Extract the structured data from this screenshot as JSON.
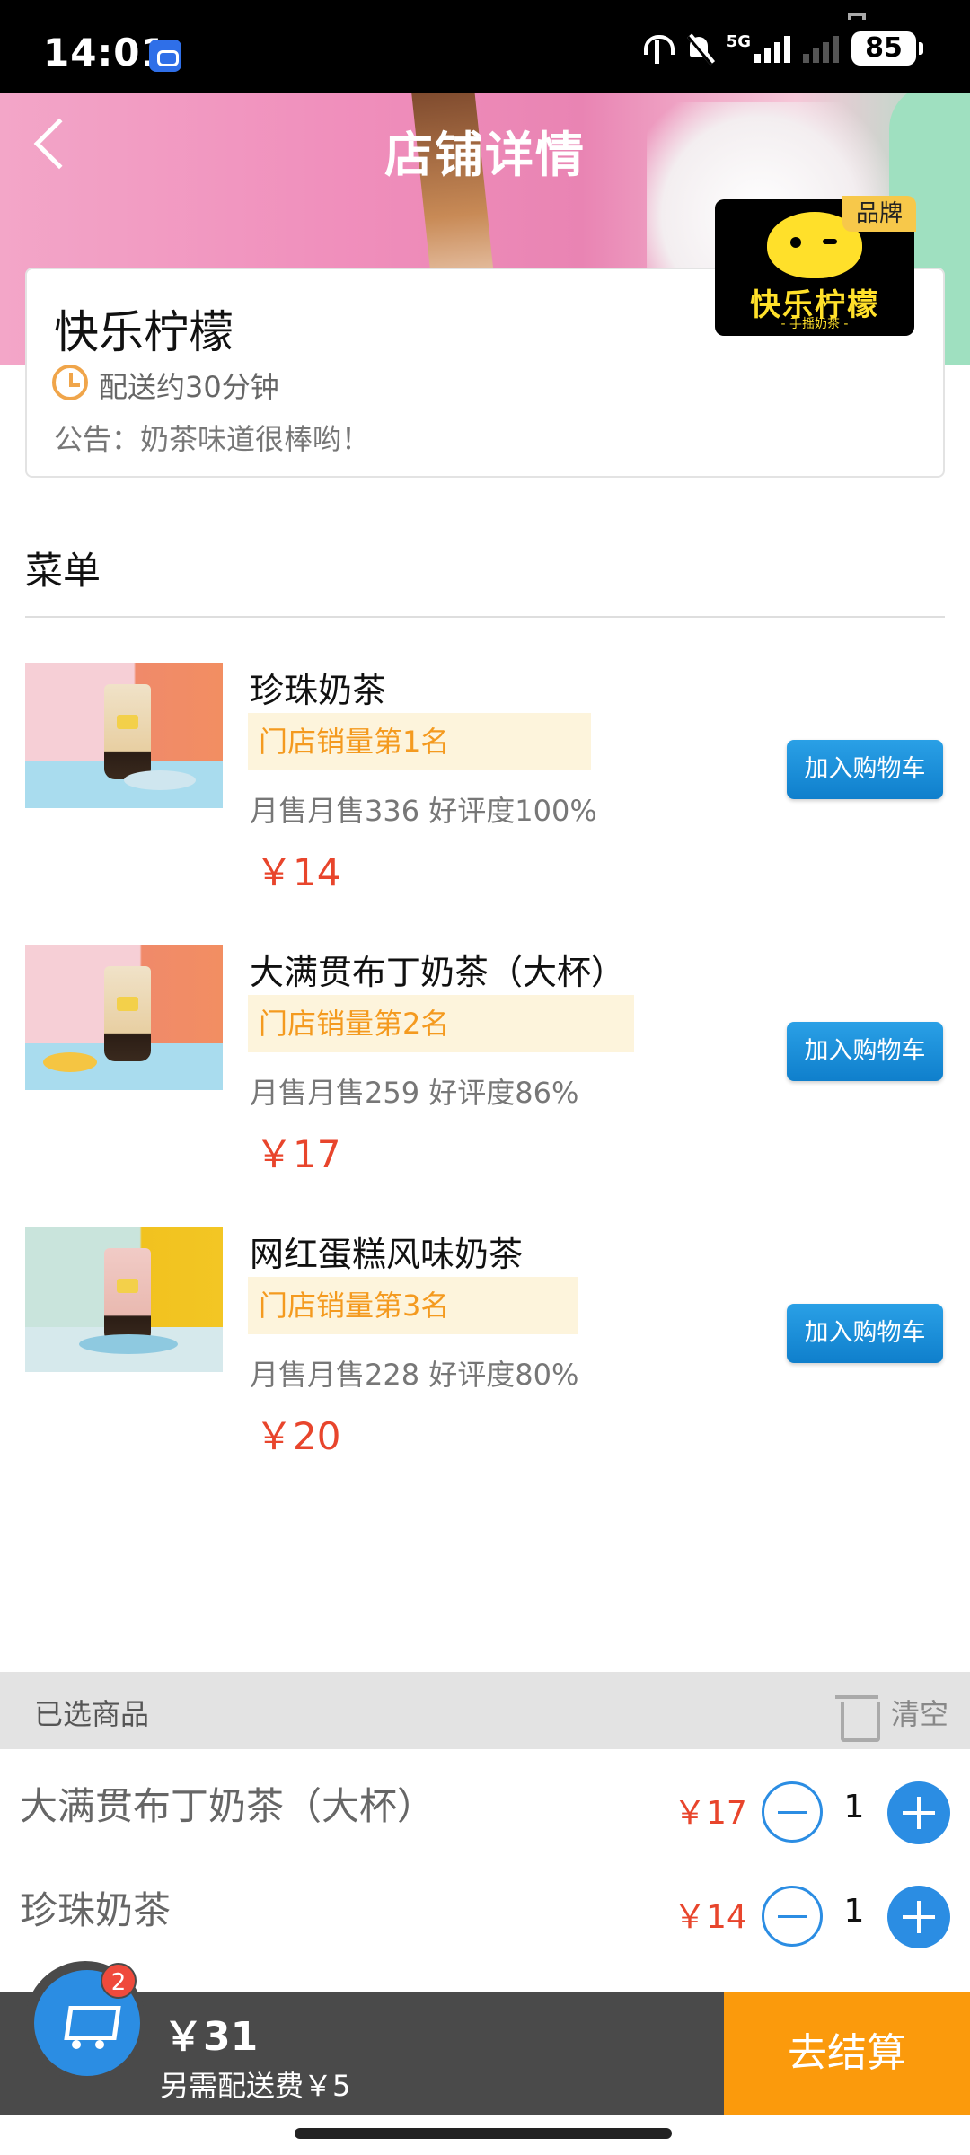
{
  "status_bar": {
    "time": "14:01",
    "network": "5G",
    "battery": "85"
  },
  "nav": {
    "title": "店铺详情"
  },
  "shop": {
    "name": "快乐柠檬",
    "delivery_time": "配送约30分钟",
    "notice": "公告：奶茶味道很棒哟！",
    "logo_text": "快乐柠檬",
    "logo_subtext": "- 手摇奶茶 -",
    "brand_tag": "品牌"
  },
  "menu": {
    "title": "菜单",
    "products": [
      {
        "name": "珍珠奶茶",
        "rank": "门店销量第1名",
        "sales": "月售月售336 好评度100%",
        "price": "￥14",
        "add_label": "加入购物车"
      },
      {
        "name": "大满贯布丁奶茶（大杯）",
        "rank": "门店销量第2名",
        "sales": "月售月售259 好评度86%",
        "price": "￥17",
        "add_label": "加入购物车"
      },
      {
        "name": "网红蛋糕风味奶茶",
        "rank": "门店销量第3名",
        "sales": "月售月售228 好评度80%",
        "price": "￥20",
        "add_label": "加入购物车"
      }
    ]
  },
  "selected": {
    "title": "已选商品",
    "clear_label": "清空",
    "items": [
      {
        "name": "大满贯布丁奶茶（大杯）",
        "price": "￥17",
        "qty": "1"
      },
      {
        "name": "珍珠奶茶",
        "price": "￥14",
        "qty": "1"
      }
    ]
  },
  "cart": {
    "badge": "2",
    "total": "￥31",
    "delivery_fee": "另需配送费￥5",
    "checkout_label": "去结算"
  },
  "colors": {
    "accent_blue": "#2b8de3",
    "price_red": "#e8452c",
    "checkout_orange": "#fb9a0c",
    "rank_orange": "#f49a1f"
  }
}
